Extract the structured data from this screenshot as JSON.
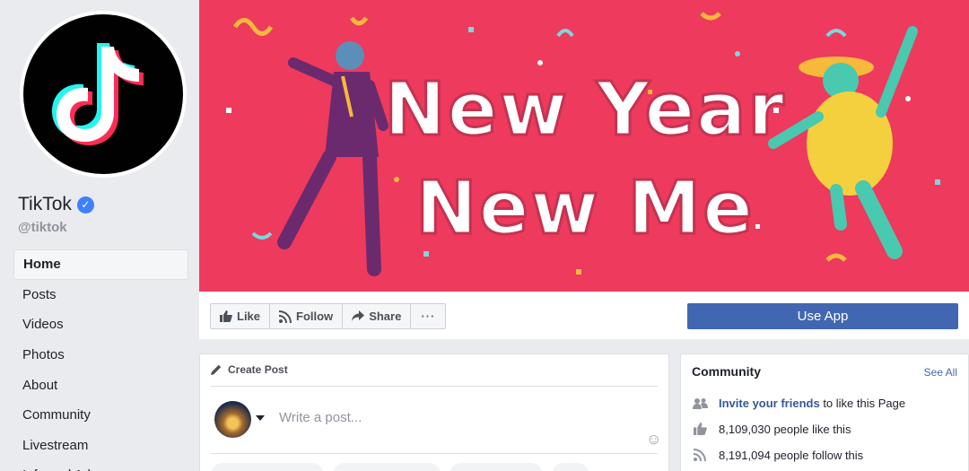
{
  "page": {
    "name": "TikTok",
    "verified_mark": "✓",
    "handle": "@tiktok"
  },
  "sidebar": {
    "items": [
      {
        "label": "Home",
        "active": true
      },
      {
        "label": "Posts"
      },
      {
        "label": "Videos"
      },
      {
        "label": "Photos"
      },
      {
        "label": "About"
      },
      {
        "label": "Community"
      },
      {
        "label": "Livestream"
      },
      {
        "label": "Info and Ads"
      }
    ]
  },
  "cover": {
    "headline": "New Year New Me",
    "background_color": "#ee3a5c"
  },
  "actions": {
    "like": "Like",
    "follow": "Follow",
    "share": "Share",
    "more": "···",
    "use_app": "Use App",
    "use_app_color": "#4267b2"
  },
  "create_post": {
    "header": "Create Post",
    "placeholder": "Write a post..."
  },
  "community": {
    "title": "Community",
    "see_all": "See All",
    "invite_link": "Invite your friends",
    "invite_rest": " to like this Page",
    "likes": "8,109,030 people like this",
    "follows": "8,191,094 people follow this"
  },
  "icons": [
    "tiktok-logo-icon",
    "verified-badge-icon",
    "thumbs-up-icon",
    "rss-icon",
    "share-arrow-icon",
    "pencil-icon",
    "emoji-icon",
    "people-icon"
  ]
}
